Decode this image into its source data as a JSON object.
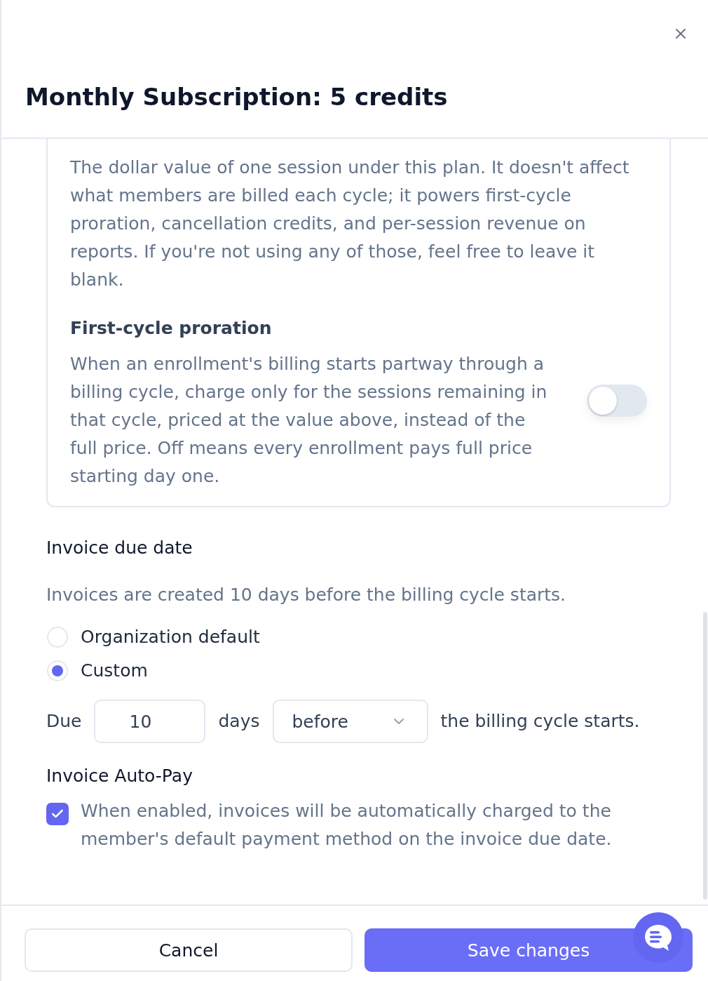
{
  "dialog": {
    "title": "Monthly Subscription: 5 credits"
  },
  "value_card": {
    "description": "The dollar value of one session under this plan. It doesn't affect what members are billed each cycle; it powers first-cycle proration, cancellation credits, and per-session revenue on reports. If you're not using any of those, feel free to leave it blank.",
    "proration": {
      "title": "First-cycle proration",
      "description": "When an enrollment's billing starts partway through a billing cycle, charge only for the sessions remaining in that cycle, priced at the value above, instead of the full price. Off means every enrollment pays full price starting day one.",
      "on": false
    }
  },
  "invoice_due_date": {
    "title": "Invoice due date",
    "note": "Invoices are created 10 days before the billing cycle starts.",
    "options": [
      {
        "label": "Organization default",
        "selected": false
      },
      {
        "label": "Custom",
        "selected": true
      }
    ],
    "due": {
      "prefix": "Due",
      "days": "10",
      "unit": "days",
      "direction": "before",
      "suffix": "the billing cycle starts."
    }
  },
  "auto_pay": {
    "title": "Invoice Auto-Pay",
    "checked": true,
    "description": "When enabled, invoices will be automatically charged to the member's default payment method on the invoice due date."
  },
  "footer": {
    "buttons": [
      {
        "label": "Cancel",
        "kind": "secondary"
      },
      {
        "label": "Save changes",
        "kind": "primary"
      }
    ]
  }
}
